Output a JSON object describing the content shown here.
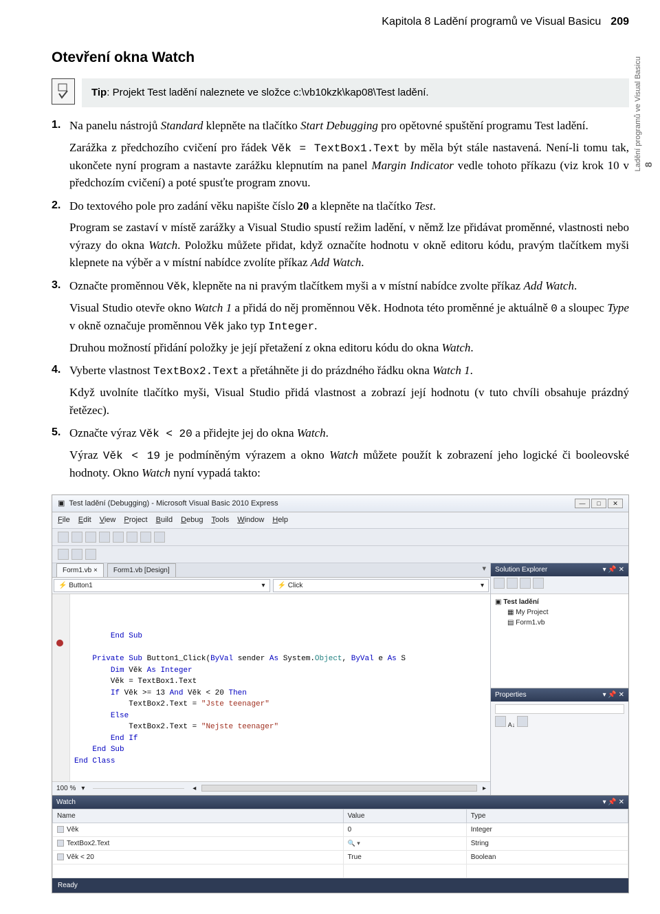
{
  "header": {
    "chapter": "Kapitola 8  Ladění programů ve Visual Basicu",
    "page": "209"
  },
  "sideTab": {
    "line1": "Ladění programů",
    "line2": "ve Visual Basicu",
    "num": "8"
  },
  "section": {
    "title": "Otevření okna Watch"
  },
  "tip": {
    "label": "Tip",
    "text": ": Projekt Test ladění naleznete ve složce c:\\vb10kzk\\kap08\\Test ladění."
  },
  "steps": [
    {
      "num": "1.",
      "parts": [
        {
          "t": "plain",
          "v": "Na panelu nástrojů "
        },
        {
          "t": "i",
          "v": "Standard"
        },
        {
          "t": "plain",
          "v": " klepněte na tlačítko "
        },
        {
          "t": "i",
          "v": "Start Debugging"
        },
        {
          "t": "plain",
          "v": " pro opětovné spuštění programu Test ladění."
        }
      ],
      "paras": [
        [
          {
            "t": "plain",
            "v": "Zarážka z předchozího cvičení pro řádek "
          },
          {
            "t": "code",
            "v": "Věk = TextBox1.Text"
          },
          {
            "t": "plain",
            "v": " by měla být stále nastavená. Není-li tomu tak, ukončete nyní program a nastavte zarážku klepnutím na panel "
          },
          {
            "t": "i",
            "v": "Margin Indicator"
          },
          {
            "t": "plain",
            "v": " vedle tohoto příkazu (viz krok 10 v předchozím cvičení) a poté spusťte program znovu."
          }
        ]
      ]
    },
    {
      "num": "2.",
      "parts": [
        {
          "t": "plain",
          "v": "Do textového pole pro zadání věku napište číslo "
        },
        {
          "t": "b",
          "v": "20"
        },
        {
          "t": "plain",
          "v": " a klepněte na tlačítko "
        },
        {
          "t": "i",
          "v": "Test"
        },
        {
          "t": "plain",
          "v": "."
        }
      ],
      "paras": [
        [
          {
            "t": "plain",
            "v": "Program se zastaví v místě zarážky a Visual Studio spustí režim ladění, v němž lze přidávat proměnné, vlastnosti nebo výrazy do okna "
          },
          {
            "t": "i",
            "v": "Watch"
          },
          {
            "t": "plain",
            "v": ". Položku můžete přidat, když označíte hodnotu v okně editoru kódu, pravým tlačítkem myši klepnete na výběr a v místní nabídce zvolíte příkaz "
          },
          {
            "t": "i",
            "v": "Add Watch"
          },
          {
            "t": "plain",
            "v": "."
          }
        ]
      ]
    },
    {
      "num": "3.",
      "parts": [
        {
          "t": "plain",
          "v": "Označte proměnnou "
        },
        {
          "t": "code",
          "v": "Věk"
        },
        {
          "t": "plain",
          "v": ", klepněte na ni pravým tlačítkem myši a v místní nabídce zvolte příkaz "
        },
        {
          "t": "i",
          "v": "Add Watch"
        },
        {
          "t": "plain",
          "v": "."
        }
      ],
      "paras": [
        [
          {
            "t": "plain",
            "v": "Visual Studio otevře okno "
          },
          {
            "t": "i",
            "v": "Watch 1"
          },
          {
            "t": "plain",
            "v": " a přidá do něj proměnnou "
          },
          {
            "t": "code",
            "v": "Věk"
          },
          {
            "t": "plain",
            "v": ". Hodnota této proměnné je aktuálně "
          },
          {
            "t": "code",
            "v": "0"
          },
          {
            "t": "plain",
            "v": " a sloupec "
          },
          {
            "t": "i",
            "v": "Type"
          },
          {
            "t": "plain",
            "v": " v okně označuje proměnnou "
          },
          {
            "t": "code",
            "v": "Věk"
          },
          {
            "t": "plain",
            "v": " jako typ "
          },
          {
            "t": "code",
            "v": "Integer"
          },
          {
            "t": "plain",
            "v": "."
          }
        ],
        [
          {
            "t": "plain",
            "v": "Druhou možností přidání položky je její přetažení z okna editoru kódu do okna "
          },
          {
            "t": "i",
            "v": "Watch"
          },
          {
            "t": "plain",
            "v": "."
          }
        ]
      ]
    },
    {
      "num": "4.",
      "parts": [
        {
          "t": "plain",
          "v": "Vyberte vlastnost "
        },
        {
          "t": "code",
          "v": "TextBox2.Text"
        },
        {
          "t": "plain",
          "v": " a přetáhněte ji do prázdného řádku okna "
        },
        {
          "t": "i",
          "v": "Watch 1"
        },
        {
          "t": "plain",
          "v": "."
        }
      ],
      "paras": [
        [
          {
            "t": "plain",
            "v": "Když uvolníte tlačítko myši, Visual Studio přidá vlastnost a zobrazí její hodnotu (v tuto chvíli obsahuje prázdný řetězec)."
          }
        ]
      ]
    },
    {
      "num": "5.",
      "parts": [
        {
          "t": "plain",
          "v": "Označte výraz "
        },
        {
          "t": "code",
          "v": "Věk < 20"
        },
        {
          "t": "plain",
          "v": " a přidejte jej do okna "
        },
        {
          "t": "i",
          "v": "Watch"
        },
        {
          "t": "plain",
          "v": "."
        }
      ],
      "paras": [
        [
          {
            "t": "plain",
            "v": "Výraz "
          },
          {
            "t": "code",
            "v": "Věk < 19"
          },
          {
            "t": "plain",
            "v": " je podmíněným výrazem a okno "
          },
          {
            "t": "i",
            "v": "Watch"
          },
          {
            "t": "plain",
            "v": " můžete použít k zobrazení jeho logické či booleovské hodnoty. Okno "
          },
          {
            "t": "i",
            "v": "Watch"
          },
          {
            "t": "plain",
            "v": " nyní vypadá takto:"
          }
        ]
      ]
    }
  ],
  "ide": {
    "title": "Test ladění (Debugging) - Microsoft Visual Basic 2010 Express",
    "menu": [
      "File",
      "Edit",
      "View",
      "Project",
      "Build",
      "Debug",
      "Tools",
      "Window",
      "Help"
    ],
    "tabs": [
      {
        "label": "Form1.vb",
        "close": "×"
      },
      {
        "label": "Form1.vb [Design]"
      }
    ],
    "combo": {
      "left": "Button1",
      "leftIcon": "⚡",
      "right": "Click",
      "rightIcon": "⚡"
    },
    "code": {
      "lines": [
        "        End Sub",
        "",
        "    Private Sub Button1_Click(ByVal sender As System.Object, ByVal e As S",
        "        Dim Věk As Integer",
        "        Věk = TextBox1.Text",
        "        If Věk >= 13 And Věk < 20 Then",
        "            TextBox2.Text = \"Jste teenager\"",
        "        Else",
        "            TextBox2.Text = \"Nejste teenager\"",
        "        End If",
        "    End Sub",
        "End Class"
      ]
    },
    "zoom": "100 %",
    "solExp": {
      "title": "Solution Explorer",
      "root": "Test ladění",
      "children": [
        "My Project",
        "Form1.vb"
      ]
    },
    "props": {
      "title": "Properties"
    },
    "watch": {
      "title": "Watch",
      "cols": [
        "Name",
        "Value",
        "Type"
      ],
      "rows": [
        {
          "name": "Věk",
          "value": "0",
          "type": "Integer"
        },
        {
          "name": "TextBox2.Text",
          "value": "",
          "type": "String",
          "mag": "🔍 ▾"
        },
        {
          "name": "Věk < 20",
          "value": "True",
          "type": "Boolean"
        }
      ]
    },
    "status": "Ready"
  }
}
